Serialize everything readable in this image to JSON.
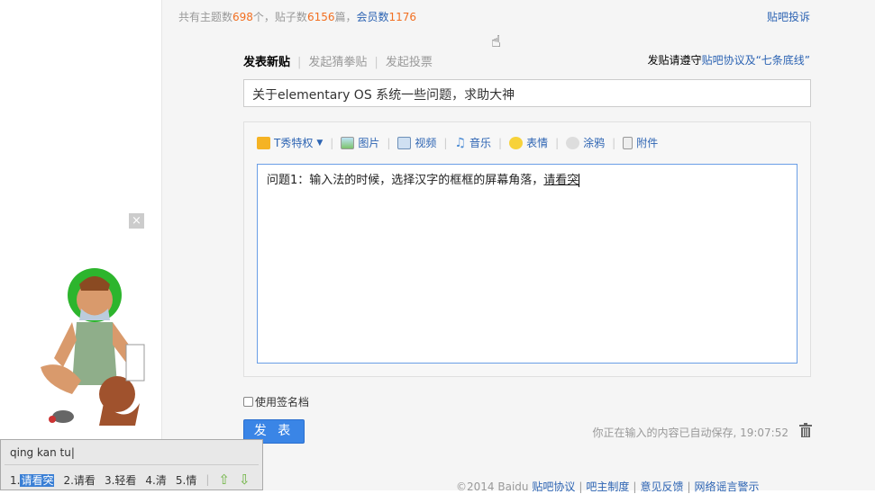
{
  "stats": {
    "prefix": "共有主题数",
    "topics": "698",
    "mid1": "个，贴子数",
    "posts": "6156",
    "mid2": "篇，",
    "members_label": "会员数",
    "members": "1176"
  },
  "complain": "贴吧投诉",
  "tabs": [
    {
      "label": "发表新贴"
    },
    {
      "label": "发起猜拳贴"
    },
    {
      "label": "发起投票"
    }
  ],
  "rules": {
    "prefix": "发贴请遵守",
    "link": "贴吧协议及“七条底线”"
  },
  "title_value": "关于elementary OS 系统一些问题，求助大神",
  "toolbar": [
    {
      "label": "T秀特权",
      "icon": "crown-icon"
    },
    {
      "label": "图片",
      "icon": "image-icon"
    },
    {
      "label": "视频",
      "icon": "video-icon"
    },
    {
      "label": "音乐",
      "icon": "music-icon"
    },
    {
      "label": "表情",
      "icon": "smiley-icon"
    },
    {
      "label": "涂鸦",
      "icon": "palette-icon"
    },
    {
      "label": "附件",
      "icon": "attachment-icon"
    }
  ],
  "editor": {
    "text": "问题1：输入法的时候，选择汉字的框框的屏幕角落，",
    "composing": "请看突"
  },
  "signature_label": "使用签名档",
  "post_button": "发 表",
  "autosave": "你正在输入的内容已自动保存, 19:07:52",
  "footer": {
    "copyright": "©2014 Baidu",
    "links": [
      "贴吧协议",
      "吧主制度",
      "意见反馈",
      "网络谣言警示"
    ]
  },
  "ime": {
    "pinyin": "qing kan tu",
    "candidates": [
      "请看突",
      "请看",
      "轻看",
      "清",
      "情"
    ]
  },
  "close_label": "×"
}
